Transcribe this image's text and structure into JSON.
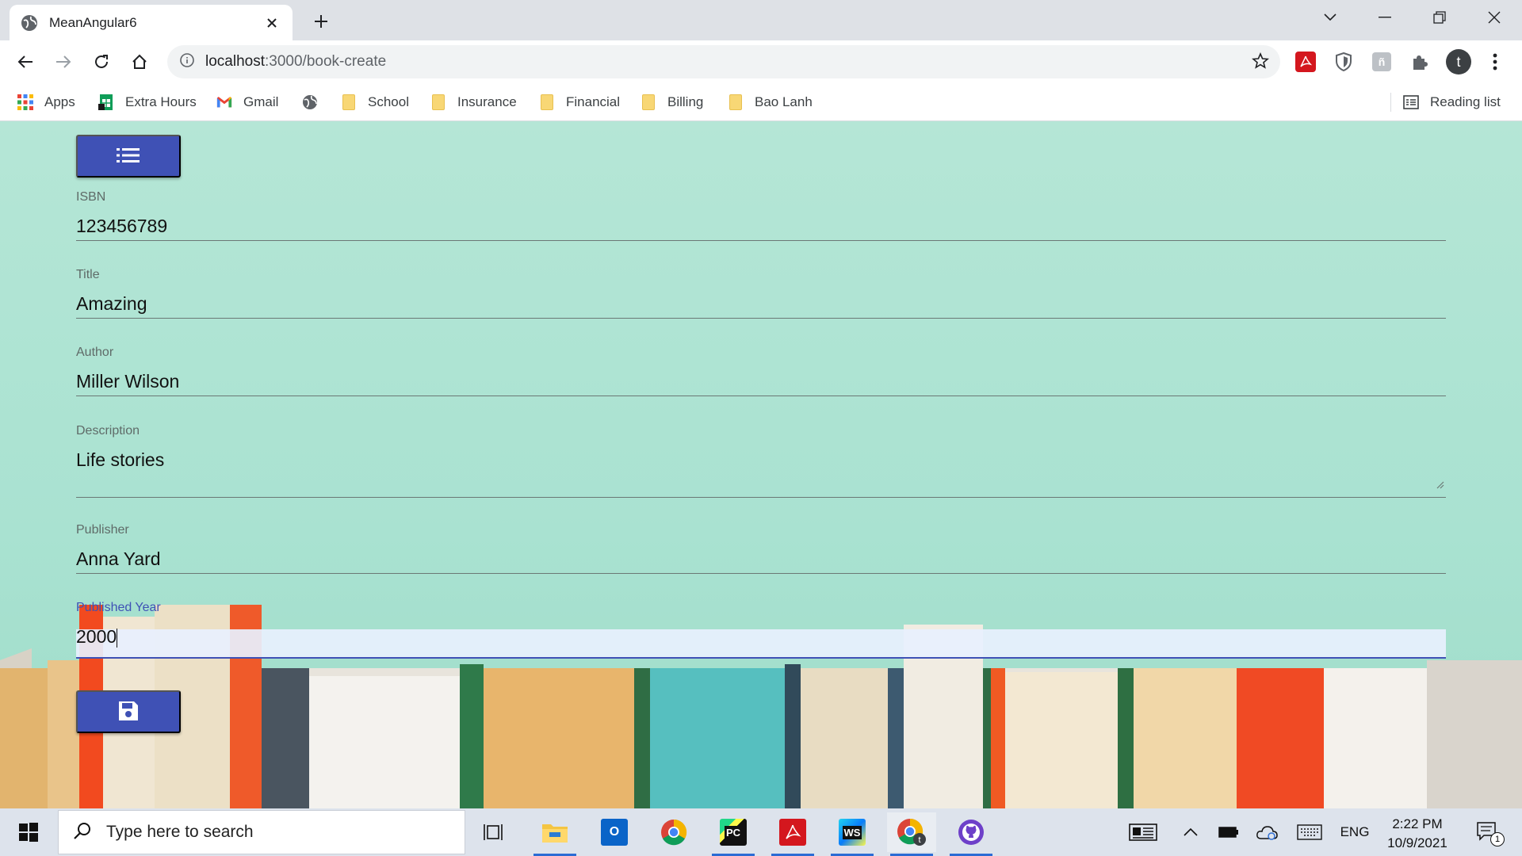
{
  "browser": {
    "tab_title": "MeanAngular6",
    "url_host": "localhost",
    "url_path": ":3000/book-create",
    "profile_initial": "t",
    "bookmarks": [
      {
        "label": "Apps",
        "icon": "apps-grid-icon"
      },
      {
        "label": "Extra Hours",
        "icon": "sheets-icon"
      },
      {
        "label": "Gmail",
        "icon": "gmail-icon"
      },
      {
        "label": "",
        "icon": "globe-icon"
      },
      {
        "label": "School",
        "icon": "folder-icon"
      },
      {
        "label": "Insurance",
        "icon": "folder-icon"
      },
      {
        "label": "Financial",
        "icon": "folder-icon"
      },
      {
        "label": "Billing",
        "icon": "folder-icon"
      },
      {
        "label": "Bao Lanh",
        "icon": "folder-icon"
      }
    ],
    "reading_list": "Reading list"
  },
  "form": {
    "menu_button_icon": "list-icon",
    "fields": [
      {
        "label": "ISBN",
        "value": "123456789"
      },
      {
        "label": "Title",
        "value": "Amazing"
      },
      {
        "label": "Author",
        "value": "Miller Wilson"
      },
      {
        "label": "Description",
        "value": "Life stories"
      },
      {
        "label": "Publisher",
        "value": "Anna Yard"
      },
      {
        "label": "Published Year",
        "value": "2000"
      }
    ],
    "save_button_icon": "floppy-disk-icon"
  },
  "taskbar": {
    "search_placeholder": "Type here to search",
    "apps": [
      "file-explorer",
      "outlook",
      "chrome",
      "pycharm",
      "acrobat",
      "webstorm",
      "chrome-profile",
      "github-desktop"
    ],
    "language": "ENG",
    "time": "2:22 PM",
    "date": "10/9/2021",
    "notification_count": "1"
  },
  "colors": {
    "primary": "#3f51b5",
    "page_background": "#b5e6d6"
  }
}
